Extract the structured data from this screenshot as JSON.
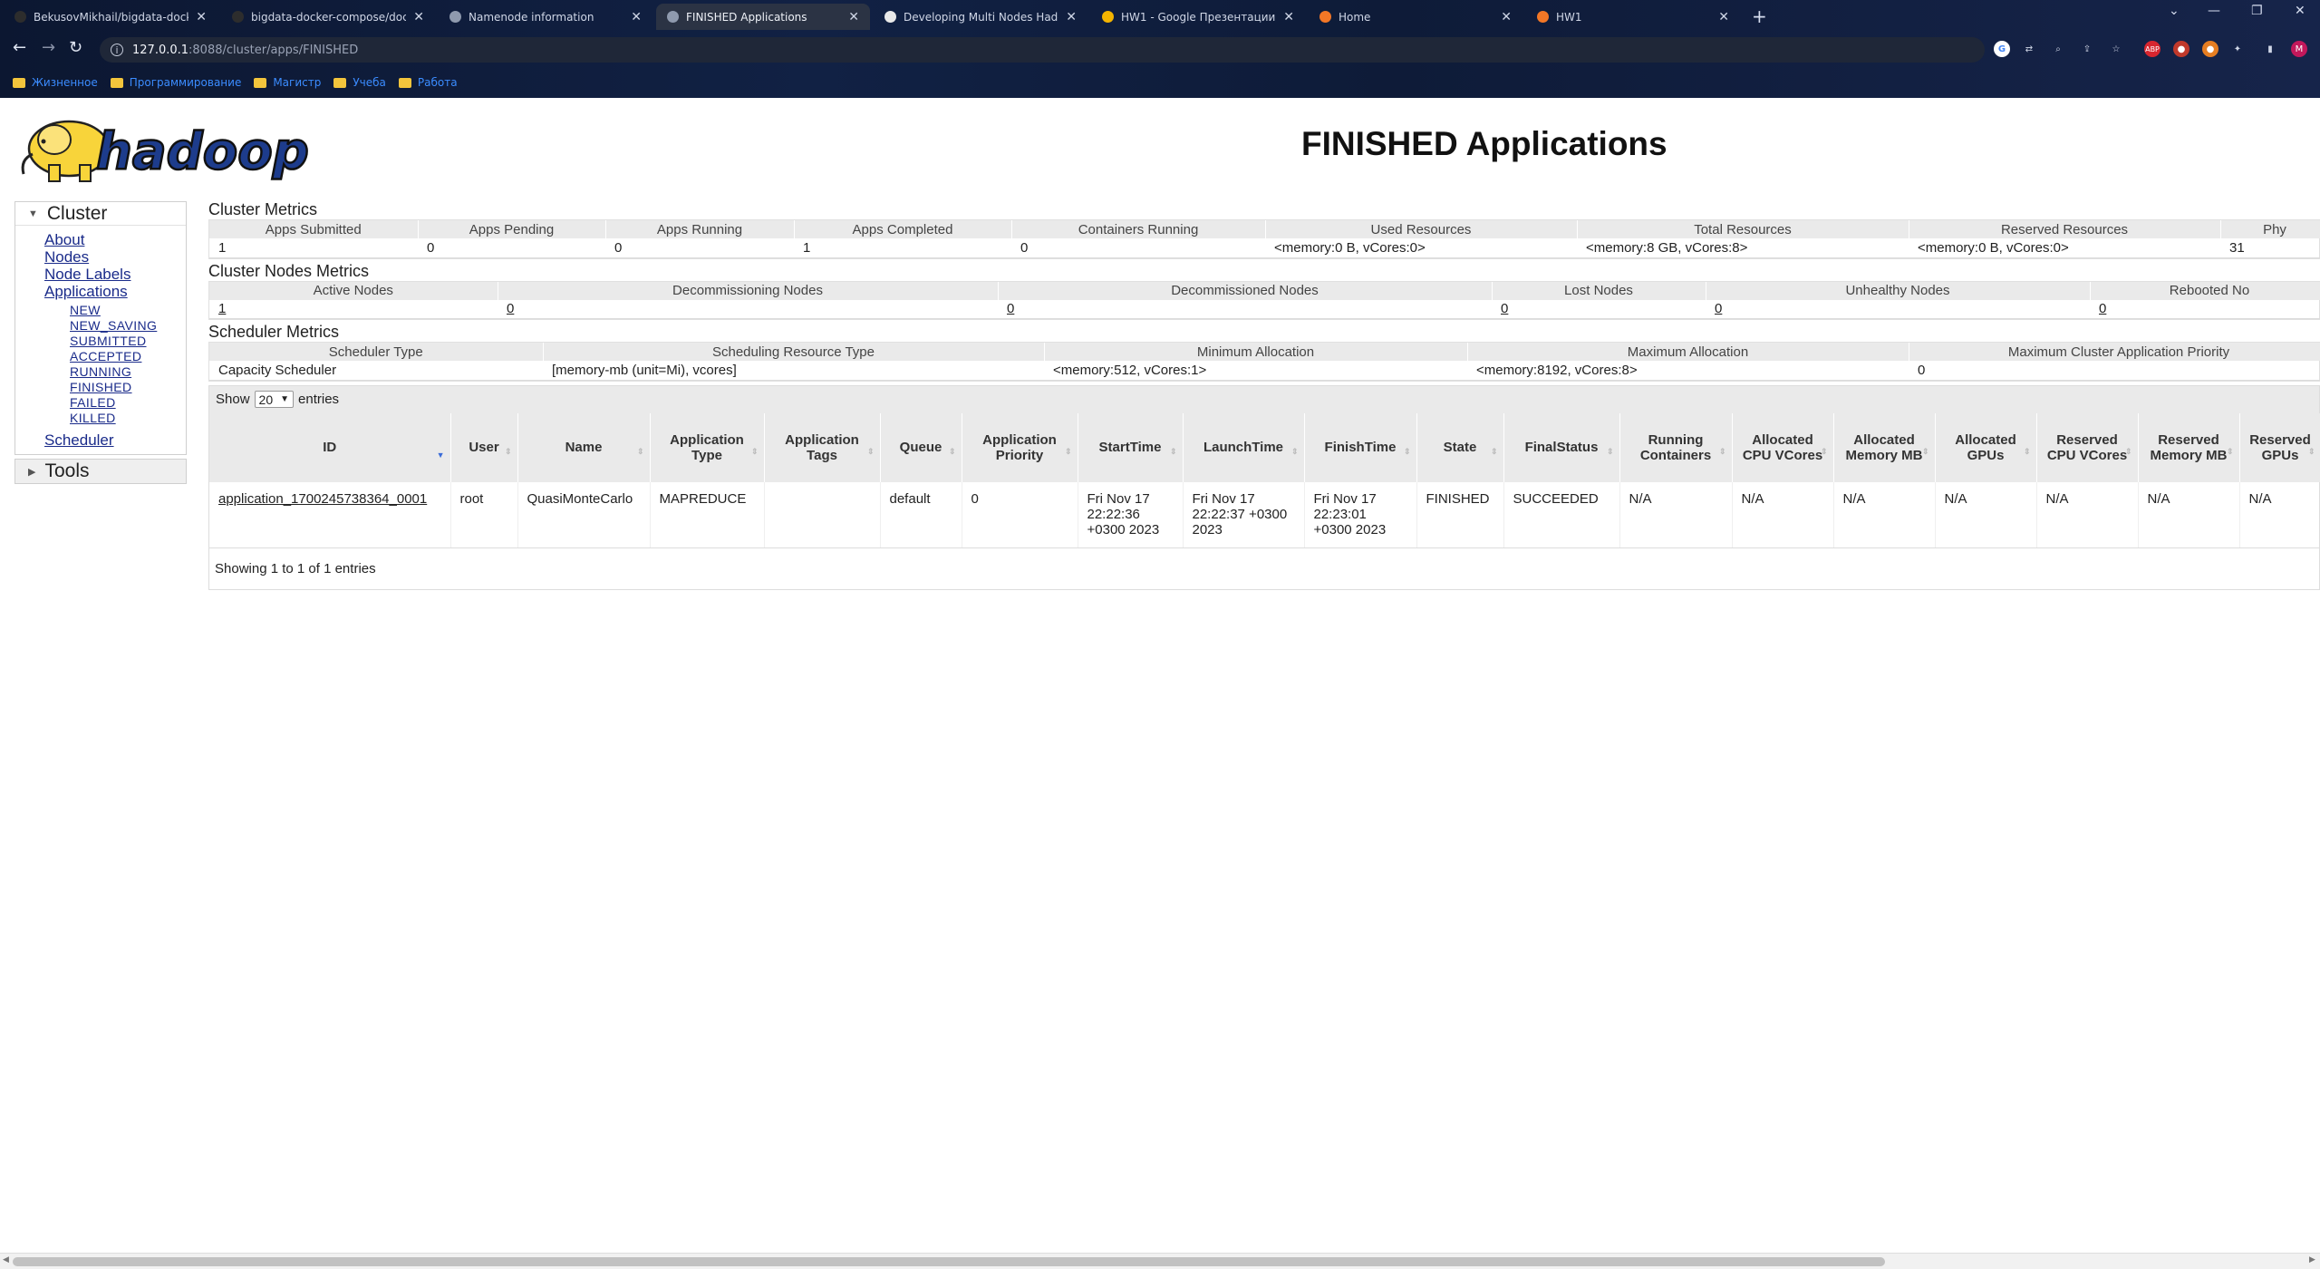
{
  "browser": {
    "tabs": [
      {
        "title": "BekusovMikhail/bigdata-docker",
        "color": "#2d2d2d"
      },
      {
        "title": "bigdata-docker-compose/docs",
        "color": "#2d2d2d"
      },
      {
        "title": "Namenode information",
        "color": "#8f9aae"
      },
      {
        "title": "FINISHED Applications",
        "color": "#8f9aae"
      },
      {
        "title": "Developing Multi Nodes Hadoop",
        "color": "#e9e9e9"
      },
      {
        "title": "HW1 - Google Презентации",
        "color": "#f4b400"
      },
      {
        "title": "Home",
        "color": "#f37726"
      },
      {
        "title": "HW1",
        "color": "#f37726"
      }
    ],
    "url_host": "127.0.0.1",
    "url_path": ":8088/cluster/apps/FINISHED",
    "bookmarks": [
      "Жизненное",
      "Программирование",
      "Магистр",
      "Учеба",
      "Работа"
    ],
    "profile_initial": "M"
  },
  "page": {
    "title": "FINISHED Applications",
    "logo_text": "hadoop"
  },
  "nav": {
    "cluster_label": "Cluster",
    "items": [
      "About",
      "Nodes",
      "Node Labels",
      "Applications"
    ],
    "app_states": [
      "NEW",
      "NEW_SAVING",
      "SUBMITTED",
      "ACCEPTED",
      "RUNNING",
      "FINISHED",
      "FAILED",
      "KILLED"
    ],
    "scheduler": "Scheduler",
    "tools_label": "Tools"
  },
  "cluster_metrics": {
    "title": "Cluster Metrics",
    "headers": [
      "Apps Submitted",
      "Apps Pending",
      "Apps Running",
      "Apps Completed",
      "Containers Running",
      "Used Resources",
      "Total Resources",
      "Reserved Resources",
      "Phy"
    ],
    "values": [
      "1",
      "0",
      "0",
      "1",
      "0",
      "<memory:0 B, vCores:0>",
      "<memory:8 GB, vCores:8>",
      "<memory:0 B, vCores:0>",
      "31"
    ]
  },
  "node_metrics": {
    "title": "Cluster Nodes Metrics",
    "headers": [
      "Active Nodes",
      "Decommissioning Nodes",
      "Decommissioned Nodes",
      "Lost Nodes",
      "Unhealthy Nodes",
      "Rebooted No"
    ],
    "values": [
      "1",
      "0",
      "0",
      "0",
      "0",
      "0"
    ]
  },
  "scheduler_metrics": {
    "title": "Scheduler Metrics",
    "headers": [
      "Scheduler Type",
      "Scheduling Resource Type",
      "Minimum Allocation",
      "Maximum Allocation",
      "Maximum Cluster Application Priority"
    ],
    "values": [
      "Capacity Scheduler",
      "[memory-mb (unit=Mi), vcores]",
      "<memory:512, vCores:1>",
      "<memory:8192, vCores:8>",
      "0"
    ]
  },
  "apps_table": {
    "show_label": "Show",
    "entries_value": "20",
    "entries_label": "entries",
    "headers": [
      "ID",
      "User",
      "Name",
      "Application Type",
      "Application Tags",
      "Queue",
      "Application Priority",
      "StartTime",
      "LaunchTime",
      "FinishTime",
      "State",
      "FinalStatus",
      "Running Containers",
      "Allocated CPU VCores",
      "Allocated Memory MB",
      "Allocated GPUs",
      "Reserved CPU VCores",
      "Reserved Memory MB",
      "Reserved GPUs"
    ],
    "rows": [
      [
        "application_1700245738364_0001",
        "root",
        "QuasiMonteCarlo",
        "MAPREDUCE",
        "",
        "default",
        "0",
        "Fri Nov 17 22:22:36 +0300 2023",
        "Fri Nov 17 22:22:37 +0300 2023",
        "Fri Nov 17 22:23:01 +0300 2023",
        "FINISHED",
        "SUCCEEDED",
        "N/A",
        "N/A",
        "N/A",
        "N/A",
        "N/A",
        "N/A",
        "N/A"
      ]
    ],
    "footer": "Showing 1 to 1 of 1 entries"
  }
}
